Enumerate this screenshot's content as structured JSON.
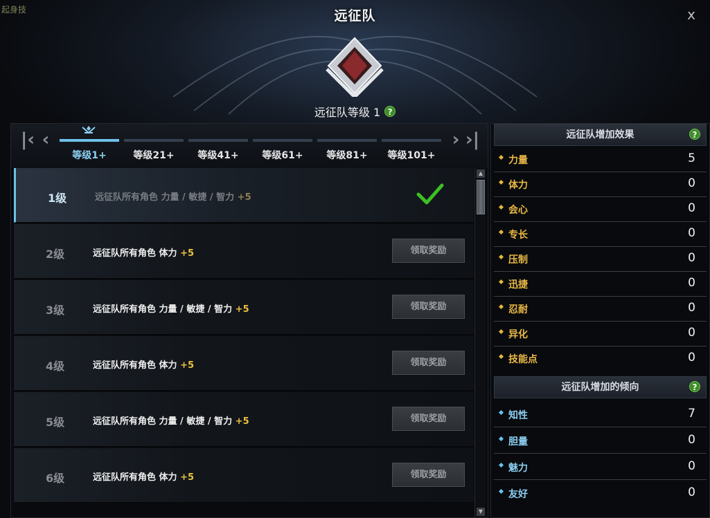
{
  "window": {
    "corner_text": "起身技",
    "title": "远征队",
    "close_label": "x",
    "rank_label": "远征队等级 1",
    "help_label": "?"
  },
  "tabs": [
    {
      "label": "等级1+",
      "active": true
    },
    {
      "label": "等级21+",
      "active": false
    },
    {
      "label": "等级41+",
      "active": false
    },
    {
      "label": "等级61+",
      "active": false
    },
    {
      "label": "等级81+",
      "active": false
    },
    {
      "label": "等级101+",
      "active": false
    }
  ],
  "nav": {
    "first": "K",
    "prev": "‹",
    "next": "›",
    "last": "K"
  },
  "levels": [
    {
      "level": "1级",
      "desc": "远征队所有角色 力量 / 敏捷 / 智力",
      "bonus": "+5",
      "status": "claimed",
      "claim_label": ""
    },
    {
      "level": "2级",
      "desc": "远征队所有角色 体力",
      "bonus": "+5",
      "status": "available",
      "claim_label": "领取奖励"
    },
    {
      "level": "3级",
      "desc": "远征队所有角色 力量 / 敏捷 / 智力",
      "bonus": "+5",
      "status": "available",
      "claim_label": "领取奖励"
    },
    {
      "level": "4级",
      "desc": "远征队所有角色 体力",
      "bonus": "+5",
      "status": "available",
      "claim_label": "领取奖励"
    },
    {
      "level": "5级",
      "desc": "远征队所有角色 力量 / 敏捷 / 智力",
      "bonus": "+5",
      "status": "available",
      "claim_label": "领取奖励"
    },
    {
      "level": "6级",
      "desc": "远征队所有角色 体力",
      "bonus": "+5",
      "status": "available",
      "claim_label": "领取奖励"
    }
  ],
  "effects": {
    "title": "远征队增加效果",
    "stats": [
      {
        "name": "力量",
        "value": "5"
      },
      {
        "name": "体力",
        "value": "0"
      },
      {
        "name": "会心",
        "value": "0"
      },
      {
        "name": "专长",
        "value": "0"
      },
      {
        "name": "压制",
        "value": "0"
      },
      {
        "name": "迅捷",
        "value": "0"
      },
      {
        "name": "忍耐",
        "value": "0"
      },
      {
        "name": "异化",
        "value": "0"
      },
      {
        "name": "技能点",
        "value": "0"
      }
    ]
  },
  "tendency": {
    "title": "远征队增加的倾向",
    "stats": [
      {
        "name": "知性",
        "value": "7"
      },
      {
        "name": "胆量",
        "value": "0"
      },
      {
        "name": "魅力",
        "value": "0"
      },
      {
        "name": "友好",
        "value": "0"
      }
    ]
  },
  "colors": {
    "accent": "#6fc1e9",
    "gold": "#e9b845",
    "bonus": "#e9c23f",
    "check": "#3cbf24"
  }
}
